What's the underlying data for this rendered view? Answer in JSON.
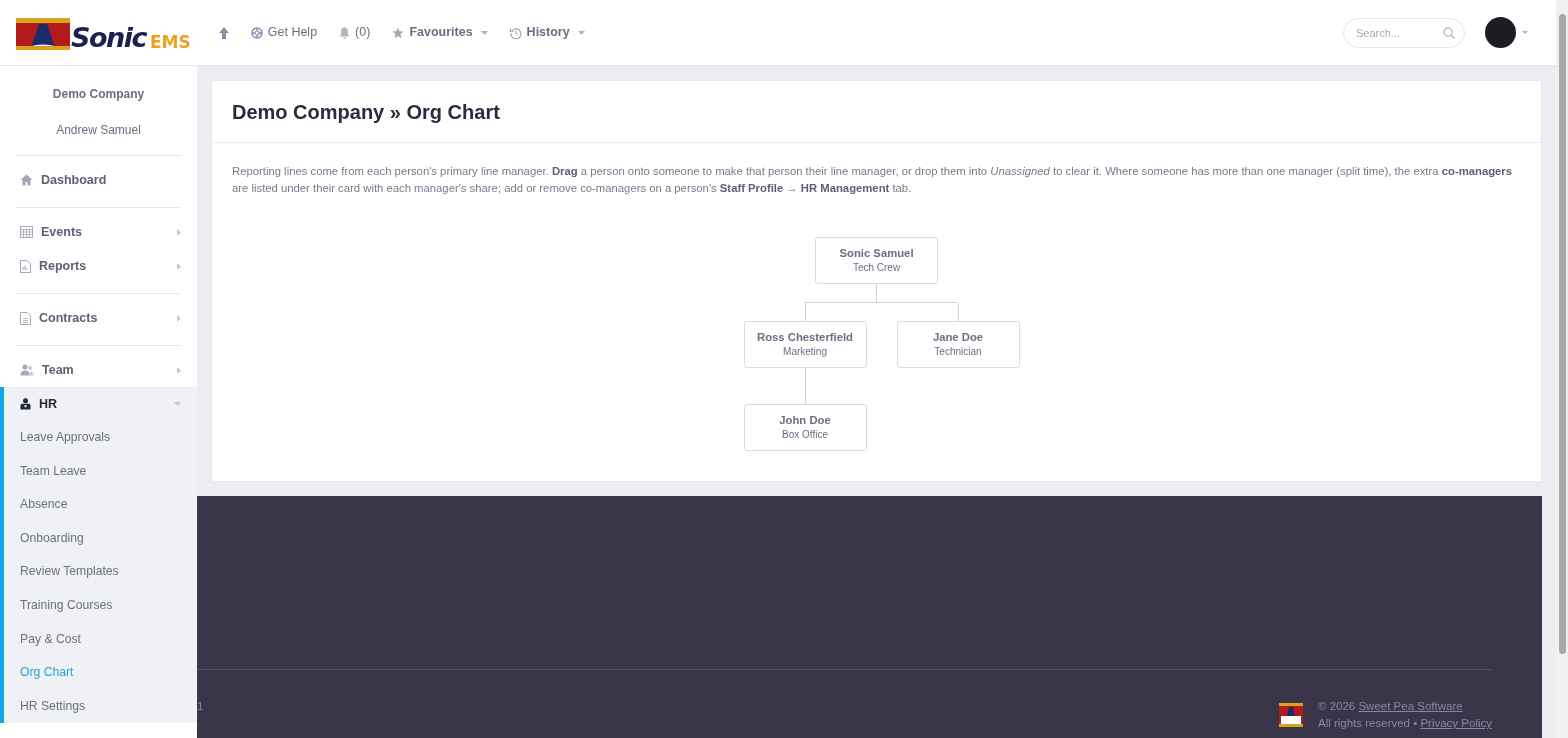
{
  "header": {
    "logo": {
      "word": "Sonic",
      "suffix": "EMS"
    },
    "nav": [
      {
        "kind": "up"
      },
      {
        "kind": "help",
        "label": "Get Help"
      },
      {
        "kind": "bell",
        "label": "(0)"
      },
      {
        "kind": "star",
        "label": "Favourites",
        "dropdown": true
      },
      {
        "kind": "history",
        "label": "History",
        "dropdown": true
      }
    ],
    "search": {
      "placeholder": "Search..."
    }
  },
  "sidebar": {
    "company": "Demo Company",
    "user": "Andrew Samuel",
    "groups": [
      {
        "items": [
          {
            "label": "Dashboard"
          }
        ]
      },
      {
        "items": [
          {
            "label": "Events",
            "expanded": false
          },
          {
            "label": "Reports",
            "expanded": false
          }
        ]
      },
      {
        "items": [
          {
            "label": "Contracts",
            "expanded": false
          }
        ]
      },
      {
        "items": [
          {
            "label": "Team",
            "expanded": false
          },
          {
            "label": "HR",
            "expanded": true,
            "children": [
              {
                "label": "Leave Approvals",
                "selected": false
              },
              {
                "label": "Team Leave",
                "selected": false
              },
              {
                "label": "Absence",
                "selected": false
              },
              {
                "label": "Onboarding",
                "selected": false
              },
              {
                "label": "Review Templates",
                "selected": false
              },
              {
                "label": "Training Courses",
                "selected": false
              },
              {
                "label": "Pay & Cost",
                "selected": false
              },
              {
                "label": "Org Chart",
                "selected": true
              },
              {
                "label": "HR Settings",
                "selected": false
              }
            ]
          }
        ]
      }
    ]
  },
  "page": {
    "title": "Demo Company » Org Chart",
    "description": "Reporting lines come from each person's primary line manager. **Drag** a person onto someone to make that person their line manager, or drop them into *Unassigned* to clear it. Where someone has more than one manager (split time), the extra **co-managers** are listed under their card with each manager's share; add or remove co-managers on a person's **Staff Profile → HR Management** tab.",
    "org_chart": {
      "name": "Sonic Samuel",
      "role": "Tech Crew",
      "children": [
        {
          "name": "Ross Chesterfield",
          "role": "Marketing",
          "children": [
            {
              "name": "John Doe",
              "role": "Box Office"
            }
          ]
        },
        {
          "name": "Jane Doe",
          "role": "Technician"
        }
      ]
    }
  },
  "footer": {
    "version_fragment": "1",
    "copyright": "© 2026 ",
    "company_link": "Sweet Pea Software",
    "rights": "All rights reserved • ",
    "privacy_link": "Privacy Policy"
  }
}
